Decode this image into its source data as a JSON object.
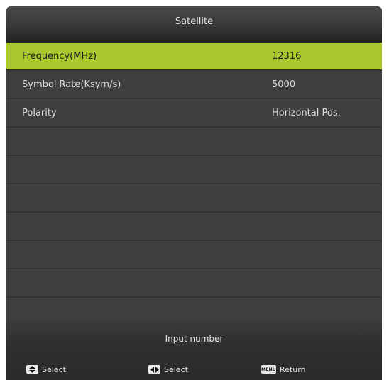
{
  "header": {
    "title": "Satellite"
  },
  "rows": [
    {
      "label": "Frequency(MHz)",
      "value": "12316",
      "selected": true
    },
    {
      "label": "Symbol Rate(Ksym/s)",
      "value": "5000",
      "selected": false
    },
    {
      "label": "Polarity",
      "value": "Horizontal Pos.",
      "selected": false
    },
    {
      "label": "",
      "value": "",
      "selected": false
    },
    {
      "label": "",
      "value": "",
      "selected": false
    },
    {
      "label": "",
      "value": "",
      "selected": false
    },
    {
      "label": "",
      "value": "",
      "selected": false
    },
    {
      "label": "",
      "value": "",
      "selected": false
    },
    {
      "label": "",
      "value": "",
      "selected": false
    },
    {
      "label": "",
      "value": "",
      "selected": false
    }
  ],
  "footer": {
    "hint": "Input number",
    "keys": [
      {
        "icon": "up-down-arrows-icon",
        "label": "Select"
      },
      {
        "icon": "left-right-arrows-icon",
        "label": "Select"
      },
      {
        "icon": "menu-key-icon",
        "icon_text": "MENU",
        "label": "Return"
      }
    ]
  },
  "colors": {
    "selected_row": "#a8c82e",
    "row_background": "#3f3f3f",
    "frame_background": "#101010"
  }
}
